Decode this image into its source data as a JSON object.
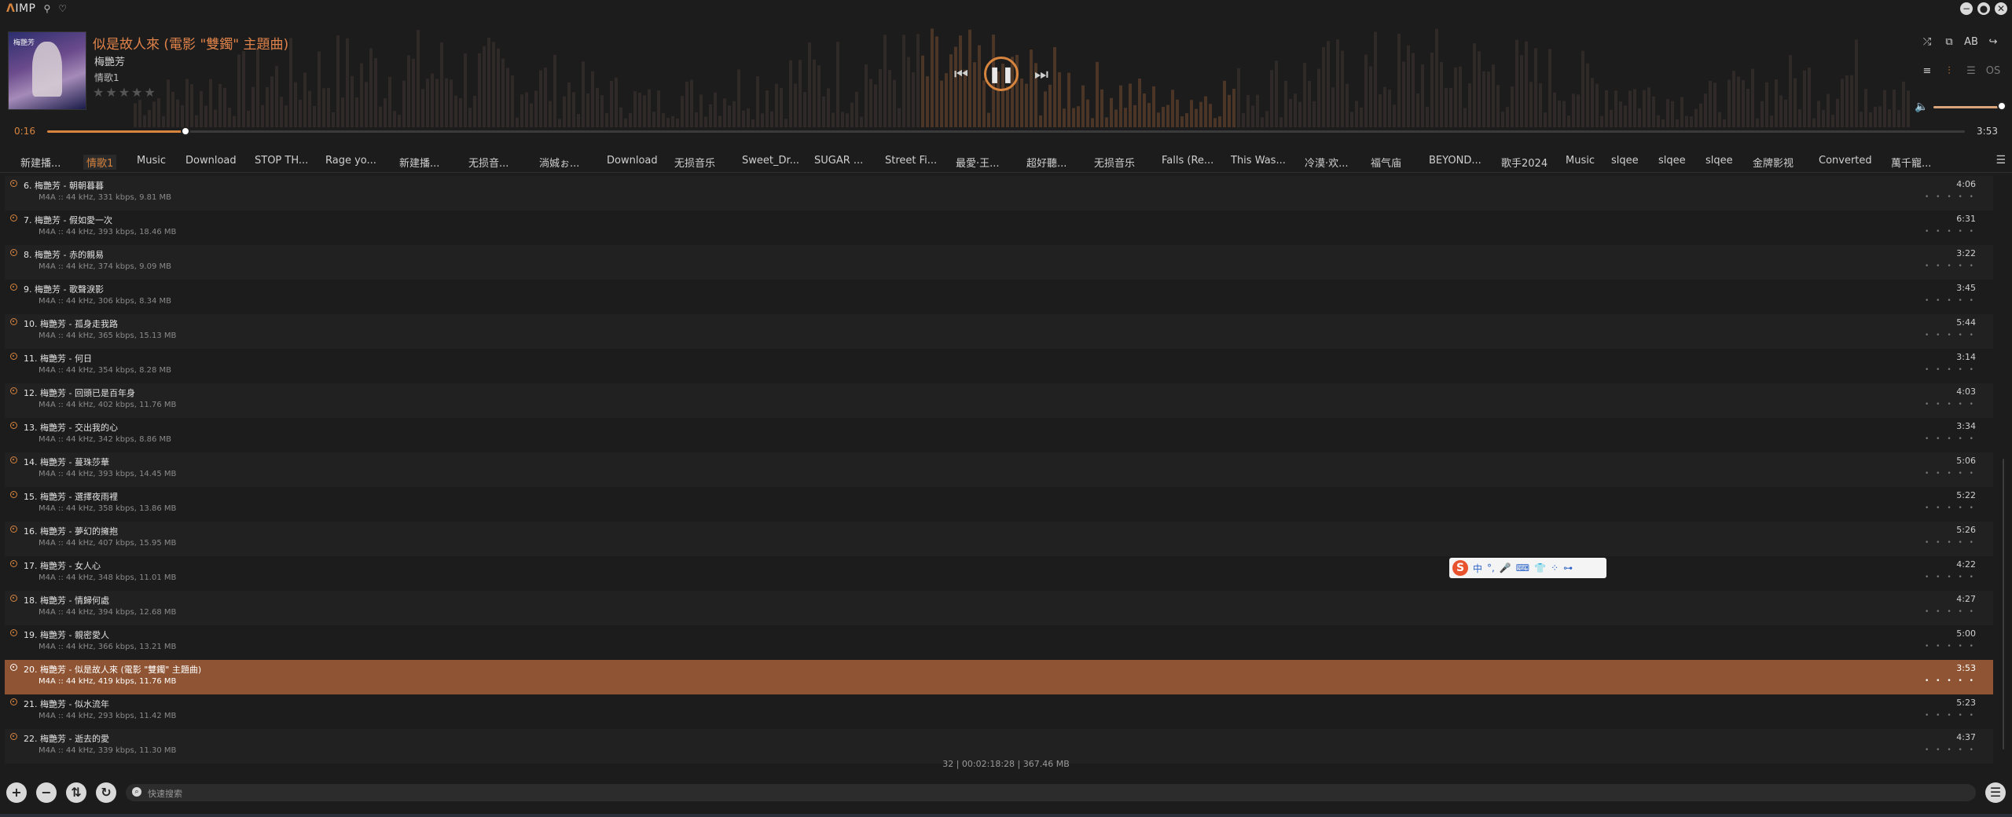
{
  "app": {
    "logo_prefix": "Ʌ",
    "logo_name": "IMP"
  },
  "top_icons": [
    "pin-icon",
    "skin-icon"
  ],
  "window_buttons": [
    "−",
    "●",
    "✕"
  ],
  "now_playing": {
    "title": "似是故人來 (電影 \"雙鐲\" 主題曲)",
    "artist": "梅艷芳",
    "album": "情歌1",
    "rating": "★★★★★",
    "cover_text": "梅艷芳"
  },
  "controls": {
    "prev": "⏮",
    "pause": "❚❚",
    "next": "⏭"
  },
  "right_icons": [
    {
      "name": "shuffle-icon",
      "glyph": "⤮",
      "state": ""
    },
    {
      "name": "repeat-icon",
      "glyph": "⧉",
      "state": ""
    },
    {
      "name": "ab-repeat-icon",
      "glyph": "AB",
      "state": ""
    },
    {
      "name": "next-track-mode-icon",
      "glyph": "↪",
      "state": ""
    },
    {
      "name": "queue-icon",
      "glyph": "≡",
      "state": ""
    },
    {
      "name": "equalizer-icon",
      "glyph": "⫶",
      "state": "on"
    },
    {
      "name": "text-list-icon",
      "glyph": "☰",
      "state": "dim"
    },
    {
      "name": "os-icon",
      "glyph": "OS",
      "state": "dim"
    }
  ],
  "volume": {
    "icon": "🔈",
    "level": 0.95
  },
  "seek": {
    "current": "0:16",
    "total": "3:53",
    "progress": 0.072
  },
  "tabs": [
    "新建播...",
    "情歌1",
    "Music",
    "Download",
    "STOP TH...",
    "Rage yo...",
    "新建播...",
    "无损音...",
    "淌娍ぉ...",
    "Download",
    "无损音乐",
    "Sweet_Dr...",
    "SUGAR ...",
    "Street Fi...",
    "最愛·王...",
    "超好聽...",
    "无损音乐",
    "Falls (Re...",
    "This Was...",
    "冷漠·欢...",
    "福气庙",
    "BEYOND...",
    "歌手2024",
    "Music",
    "slqee",
    "slqee",
    "slqee",
    "金牌影视",
    "Converted",
    "萬千寵..."
  ],
  "active_tab": 1,
  "tracks": [
    {
      "title": "6. 梅艷芳 - 朝朝暮暮",
      "meta": "M4A :: 44 kHz, 331 kbps, 9.81 MB",
      "duration": "4:06"
    },
    {
      "title": "7. 梅艷芳 - 假如愛一次",
      "meta": "M4A :: 44 kHz, 393 kbps, 18.46 MB",
      "duration": "6:31"
    },
    {
      "title": "8. 梅艷芳 - 赤的親易",
      "meta": "M4A :: 44 kHz, 374 kbps, 9.09 MB",
      "duration": "3:22"
    },
    {
      "title": "9. 梅艷芳 - 歌聲淚影",
      "meta": "M4A :: 44 kHz, 306 kbps, 8.34 MB",
      "duration": "3:45"
    },
    {
      "title": "10. 梅艷芳 - 孤身走我路",
      "meta": "M4A :: 44 kHz, 365 kbps, 15.13 MB",
      "duration": "5:44"
    },
    {
      "title": "11. 梅艷芳 - 何日",
      "meta": "M4A :: 44 kHz, 354 kbps, 8.28 MB",
      "duration": "3:14"
    },
    {
      "title": "12. 梅艷芳 - 回頭已是百年身",
      "meta": "M4A :: 44 kHz, 402 kbps, 11.76 MB",
      "duration": "4:03"
    },
    {
      "title": "13. 梅艷芳 - 交出我的心",
      "meta": "M4A :: 44 kHz, 342 kbps, 8.86 MB",
      "duration": "3:34"
    },
    {
      "title": "14. 梅艷芳 - 蔓珠莎華",
      "meta": "M4A :: 44 kHz, 393 kbps, 14.45 MB",
      "duration": "5:06"
    },
    {
      "title": "15. 梅艷芳 - 選擇夜雨裡",
      "meta": "M4A :: 44 kHz, 358 kbps, 13.86 MB",
      "duration": "5:22"
    },
    {
      "title": "16. 梅艷芳 - 夢幻的擁抱",
      "meta": "M4A :: 44 kHz, 407 kbps, 15.95 MB",
      "duration": "5:26"
    },
    {
      "title": "17. 梅艷芳 - 女人心",
      "meta": "M4A :: 44 kHz, 348 kbps, 11.01 MB",
      "duration": "4:22"
    },
    {
      "title": "18. 梅艷芳 - 情歸何處",
      "meta": "M4A :: 44 kHz, 394 kbps, 12.68 MB",
      "duration": "4:27"
    },
    {
      "title": "19. 梅艷芳 - 親密愛人",
      "meta": "M4A :: 44 kHz, 366 kbps, 13.21 MB",
      "duration": "5:00"
    },
    {
      "title": "20. 梅艷芳 - 似是故人來 (電影 \"雙鐲\" 主題曲)",
      "meta": "M4A :: 44 kHz, 419 kbps, 11.76 MB",
      "duration": "3:53"
    },
    {
      "title": "21. 梅艷芳 - 似水流年",
      "meta": "M4A :: 44 kHz, 293 kbps, 11.42 MB",
      "duration": "5:23"
    },
    {
      "title": "22. 梅艷芳 - 逝去的愛",
      "meta": "M4A :: 44 kHz, 339 kbps, 11.30 MB",
      "duration": "4:37"
    }
  ],
  "playing_index": 14,
  "row_rating": "• • • • •",
  "ime_toolbar": {
    "logo": "S",
    "items": [
      "中",
      "°,",
      "🎤",
      "⌨",
      "👕",
      "⁘",
      "⊶"
    ]
  },
  "status": "32  |  00:02:18:28  |  367.46 MB",
  "footer": {
    "buttons": [
      {
        "name": "add-button",
        "glyph": "+"
      },
      {
        "name": "remove-button",
        "glyph": "−"
      },
      {
        "name": "sort-button",
        "glyph": "⇅"
      },
      {
        "name": "refresh-button",
        "glyph": "↻"
      }
    ],
    "search_placeholder": "快速搜索",
    "menu": "☰"
  },
  "colors": {
    "accent": "#d7843f",
    "playing_row": "#8f5433",
    "background": "#1c1c1c"
  }
}
